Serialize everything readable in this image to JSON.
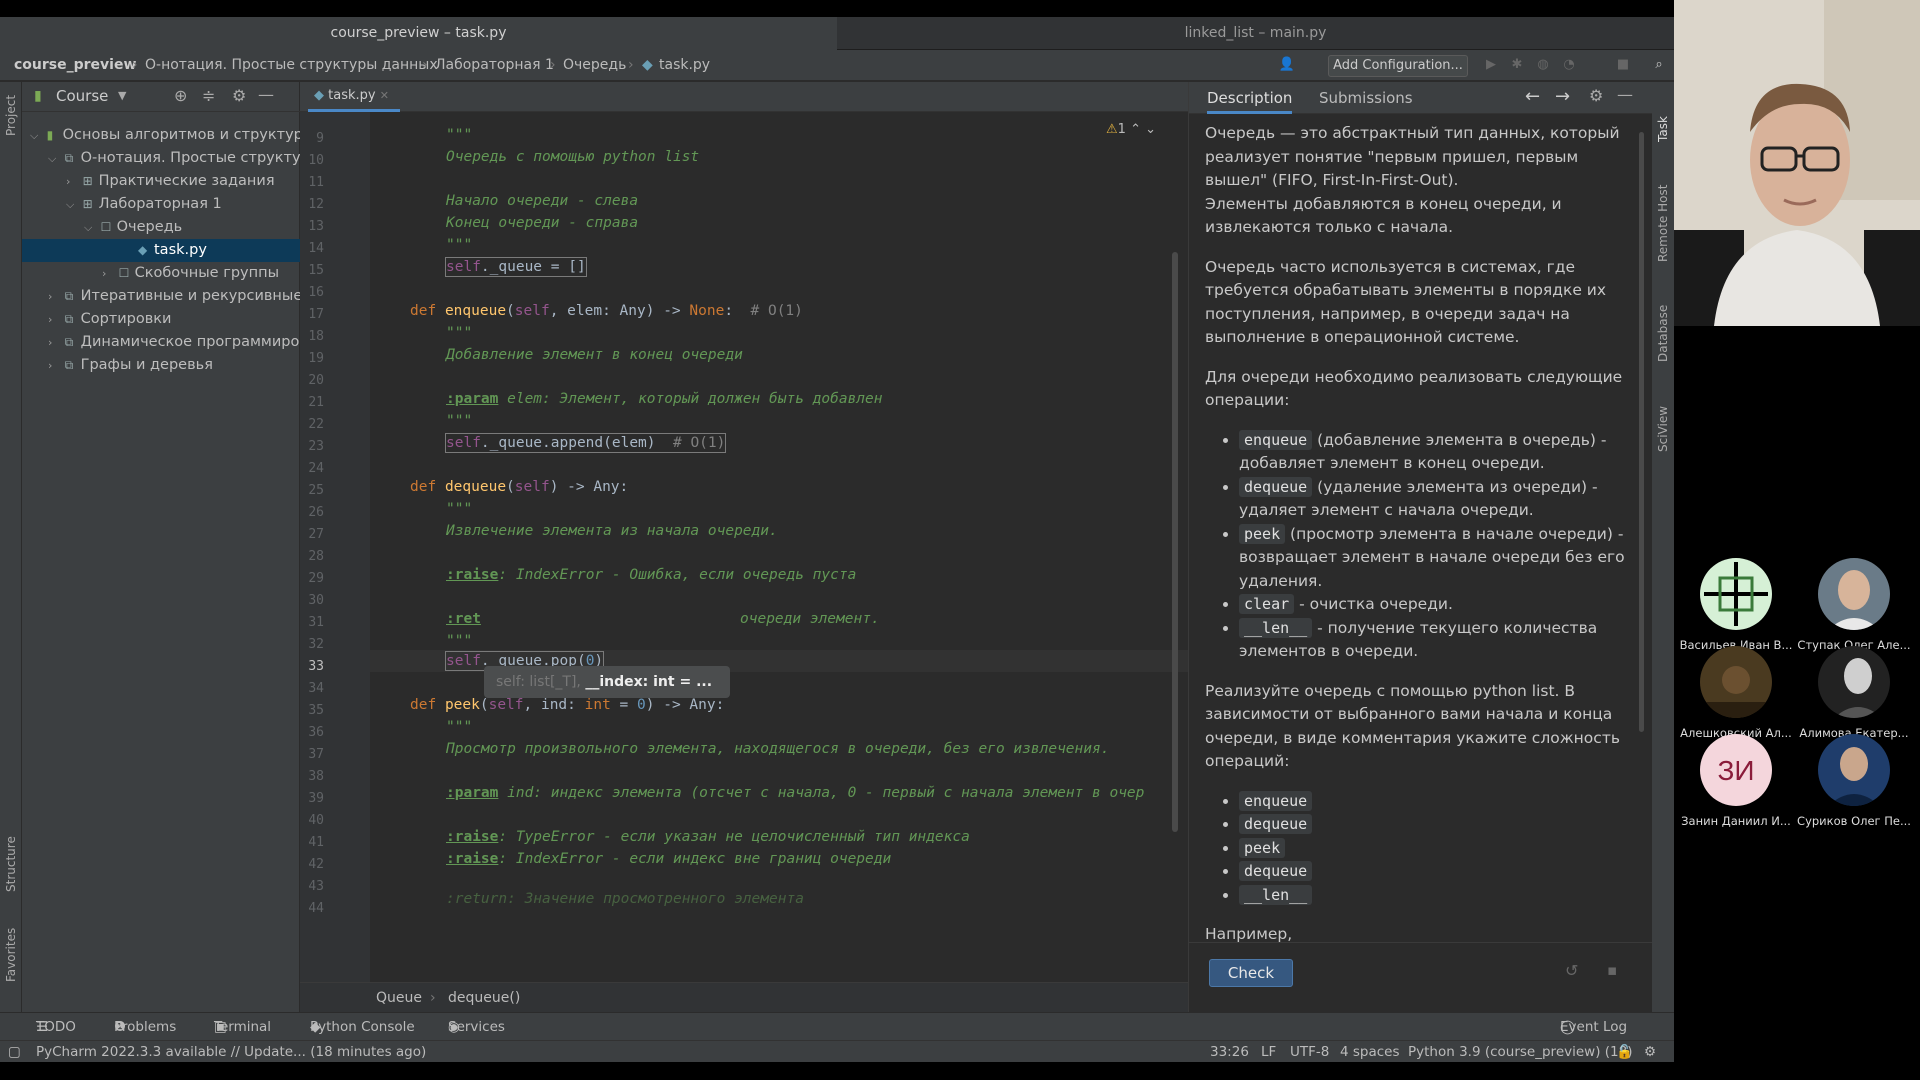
{
  "window_tabs": [
    "course_preview – task.py",
    "linked_list – main.py"
  ],
  "breadcrumbs": [
    "course_preview",
    "О-нотация. Простые структуры данных",
    "Лабораторная 1",
    "Очередь",
    "task.py"
  ],
  "toolbar": {
    "add_configuration": "Add Configuration..."
  },
  "project_panel": {
    "title": "Course",
    "side_labels": [
      "Project",
      "Structure",
      "Favorites"
    ],
    "tree": [
      {
        "label": "Основы алгоритмов и структур данных"
      },
      {
        "label": "О-нотация. Простые структуры данных"
      },
      {
        "label": "Практические задания"
      },
      {
        "label": "Лабораторная 1"
      },
      {
        "label": "Очередь"
      },
      {
        "label": "task.py"
      },
      {
        "label": "Скобочные группы"
      },
      {
        "label": "Итеративные и рекурсивные алгоритмы"
      },
      {
        "label": "Сортировки"
      },
      {
        "label": "Динамическое программирование"
      },
      {
        "label": "Графы и деревья"
      }
    ]
  },
  "editor": {
    "tab": "task.py",
    "warning_count": "1",
    "line_numbers": [
      "9",
      "10",
      "11",
      "12",
      "13",
      "14",
      "15",
      "16",
      "17",
      "18",
      "19",
      "20",
      "21",
      "22",
      "23",
      "24",
      "25",
      "26",
      "27",
      "28",
      "29",
      "30",
      "31",
      "32",
      "33",
      "34",
      "35",
      "36",
      "37",
      "38",
      "39",
      "40",
      "41",
      "42",
      "43",
      "44"
    ],
    "current_line": "33",
    "hint": {
      "dim": "self: list[_T],",
      "bold": "__index: int = ..."
    },
    "breadcrumb": [
      "Queue",
      "dequeue()"
    ],
    "code": {
      "l9": "\"\"\"",
      "l10": "Очередь с помощью python list",
      "l12": "Начало очереди - слева",
      "l13": "Конец очереди - справа",
      "l14": "\"\"\"",
      "l15": "self._queue = []",
      "l17": "def enqueue(self, elem: Any) -> None:  # O(1)",
      "l18": "\"\"\"",
      "l19": "Добавление элемент в конец очереди",
      "l21_tag": ":param",
      "l21": " elem: Элемент, который должен быть добавлен",
      "l22": "\"\"\"",
      "l23": "self._queue.append(elem)  # O(1)",
      "l25": "def dequeue(self) -> Any:",
      "l26": "\"\"\"",
      "l27": "Извлечение элемента из начала очереди.",
      "l29_tag": ":raise",
      "l29": ": IndexError - Ошибка, если очередь пуста",
      "l31_tag": ":ret",
      "l31": "очереди элемент.",
      "l32": "\"\"\"",
      "l33": "self._queue.pop(0)",
      "l35": "def peek(self, ind: int = 0) -> Any:",
      "l36": "\"\"\"",
      "l37": "Просмотр произвольного элемента, находящегося в очереди, без его извлечения.",
      "l39_tag": ":param",
      "l39": " ind: индекс элемента (отсчет с начала, 0 - первый с начала элемент в очер",
      "l41_tag": ":raise",
      "l41": ": TypeError - если указан не целочисленный тип индекса",
      "l42_tag": ":raise",
      "l42": ": IndexError - если индекс вне границ очереди",
      "l44": ":return: Значение просмотренного элемента"
    }
  },
  "task_panel": {
    "tabs": [
      "Description",
      "Submissions"
    ],
    "p1": "Очередь — это абстрактный тип данных, который реализует понятие \"первым пришел, первым вышел\" (FIFO, First-In-First-Out).",
    "p1b": "Элементы добавляются в конец очереди, и извлекаются только с начала.",
    "p2": "Очередь часто используется в системах, где требуется обрабатывать элементы в порядке их поступления, например, в очереди задач на выполнение в операционной системе.",
    "p3": "Для очереди необходимо реализовать следующие операции:",
    "ops": [
      {
        "code": "enqueue",
        "text": " (добавление элемента в очередь) - добавляет элемент в конец очереди."
      },
      {
        "code": "dequeue",
        "text": " (удаление элемента из очереди) - удаляет элемент с начала очереди."
      },
      {
        "code": "peek",
        "text": " (просмотр элемента в начале очереди) - возвращает элемент в начале очереди без его удаления."
      },
      {
        "code": "clear",
        "text": " - очистка очереди."
      },
      {
        "code": "__len__",
        "text": " - получение текущего количества элементов в очереди."
      }
    ],
    "p4": "Реализуйте очередь с помощью python list. В зависимости от выбранного вами начала и конца очереди, в виде комментария укажите сложность операций:",
    "ops2": [
      "enqueue",
      "dequeue",
      "peek",
      "dequeue",
      "__len__"
    ],
    "p5": "Например,",
    "check": "Check"
  },
  "right_strip": [
    "Task",
    "Remote Host",
    "Database",
    "SciView"
  ],
  "tool_windows": [
    "TODO",
    "Problems",
    "Terminal",
    "Python Console",
    "Services",
    "Event Log"
  ],
  "status": {
    "message": "PyCharm 2022.3.3 available // Update... (18 minutes ago)",
    "position": "33:26",
    "line_sep": "LF",
    "encoding": "UTF-8",
    "indent": "4 spaces",
    "interpreter": "Python 3.9 (course_preview) (18)"
  },
  "participants": [
    {
      "name": "Васильев Иван В...",
      "initials": "",
      "color": "#d6f0d6"
    },
    {
      "name": "Ступак Олег Але...",
      "initials": "",
      "color": "#6a7b88"
    },
    {
      "name": "Алешковский Ал...",
      "initials": "",
      "color": "#4a3a20"
    },
    {
      "name": "Алимова Екатер...",
      "initials": "",
      "color": "#222222"
    },
    {
      "name": "Занин Даниил И...",
      "initials": "ЗИ",
      "color": "#f4d6dc"
    },
    {
      "name": "Суриков Олег Пе...",
      "initials": "",
      "color": "#1f3d6b"
    }
  ]
}
